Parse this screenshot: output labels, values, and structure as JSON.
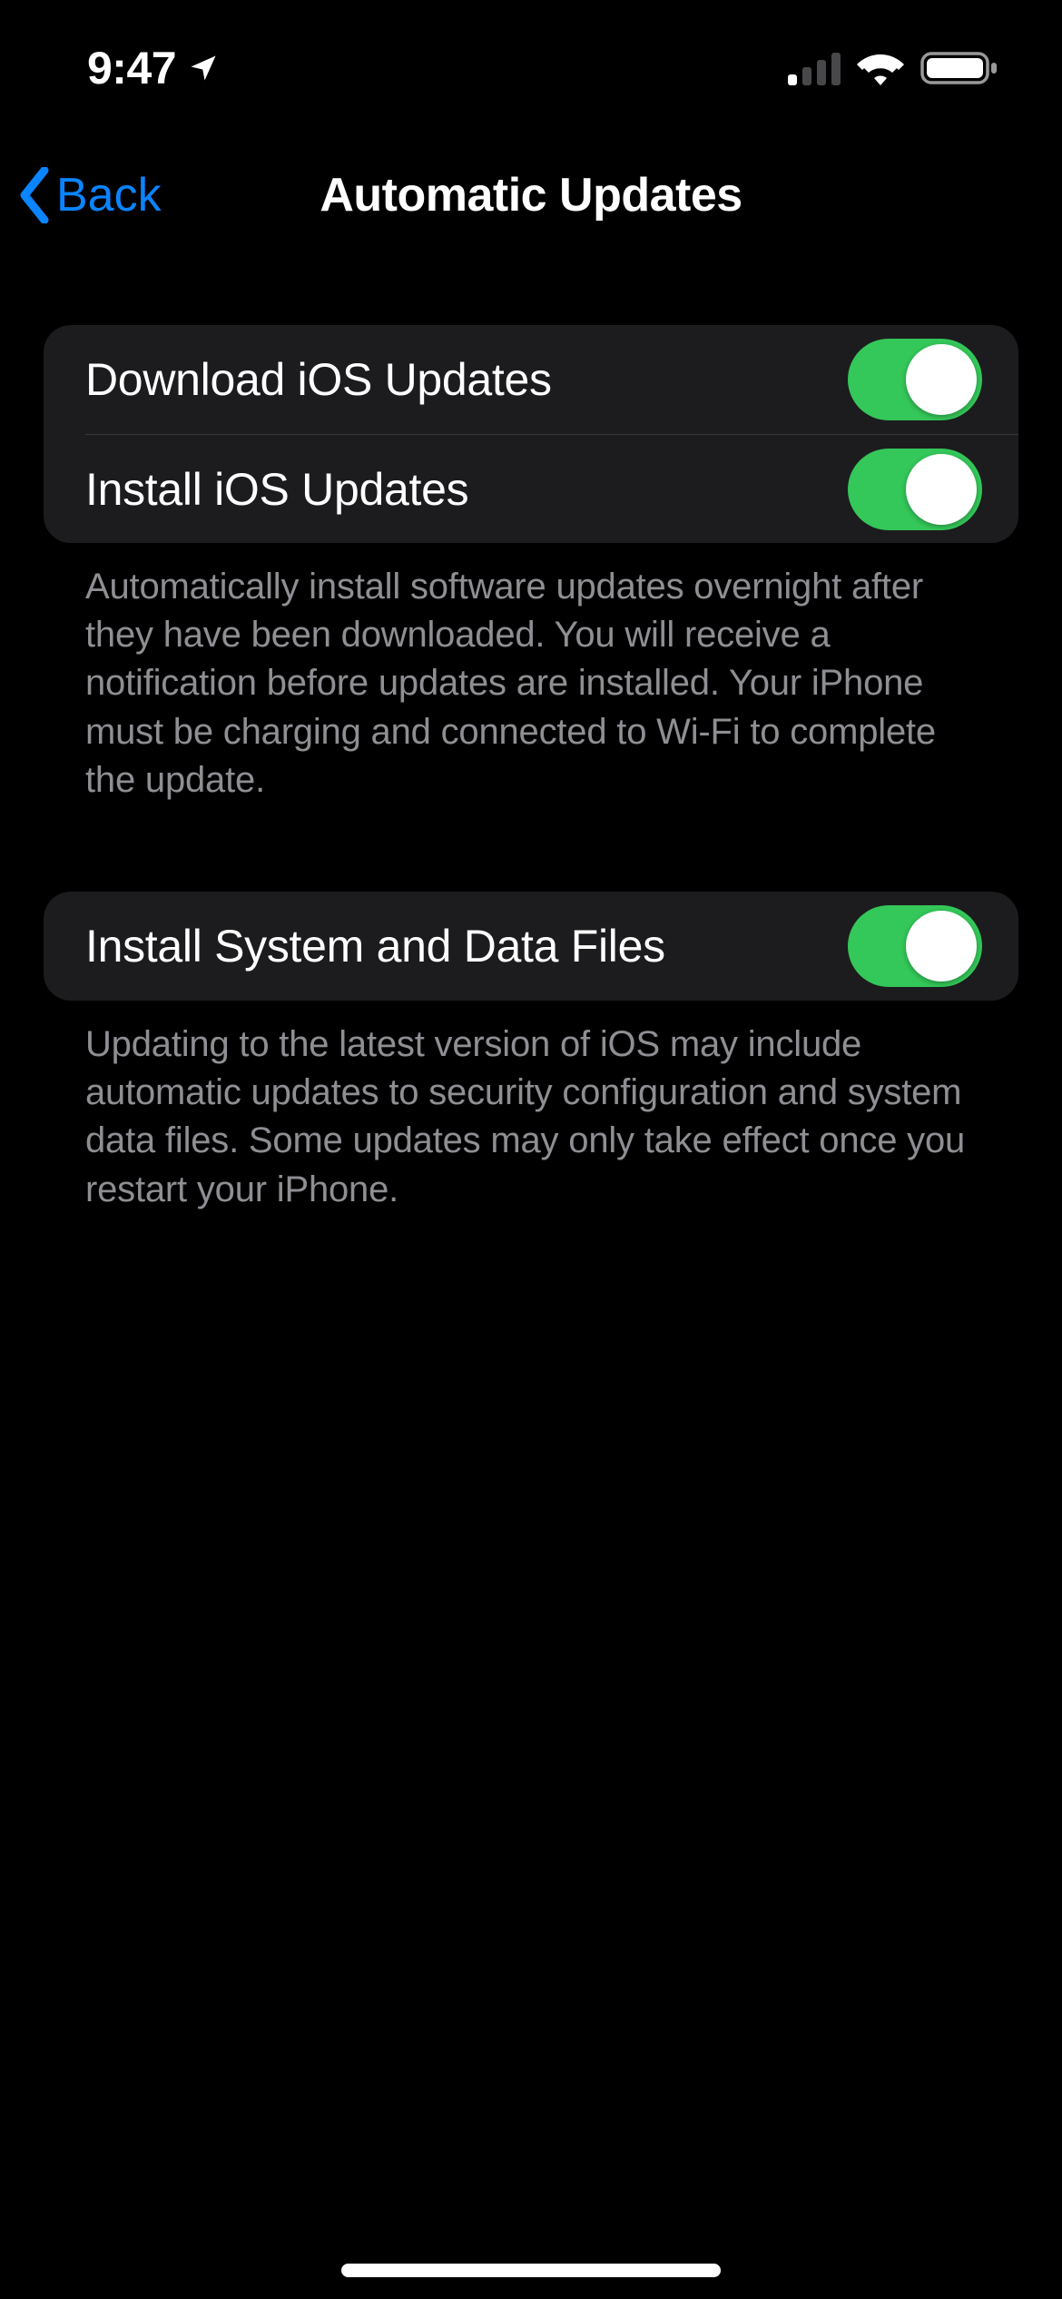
{
  "status_bar": {
    "time": "9:47",
    "cellular_bars": 1,
    "cellular_total_bars": 4,
    "wifi": true,
    "battery_full": true
  },
  "nav": {
    "back_label": "Back",
    "title": "Automatic Updates"
  },
  "groups": [
    {
      "rows": [
        {
          "label": "Download iOS Updates",
          "on": true
        },
        {
          "label": "Install iOS Updates",
          "on": true
        }
      ],
      "footer": "Automatically install software updates overnight after they have been downloaded. You will receive a notification before updates are installed. Your iPhone must be charging and connected to Wi-Fi to complete the update."
    },
    {
      "rows": [
        {
          "label": "Install System and Data Files",
          "on": true
        }
      ],
      "footer": "Updating to the latest version of iOS may include automatic updates to security configuration and system data files. Some updates may only take effect once you restart your iPhone."
    }
  ],
  "colors": {
    "accent_blue": "#0a84ff",
    "toggle_green": "#34c759",
    "group_bg": "#1c1c1e",
    "footer_gray": "#8e8e93"
  }
}
